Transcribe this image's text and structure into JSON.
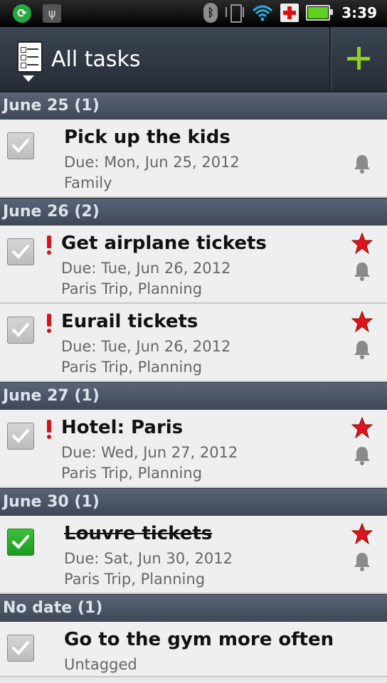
{
  "status_bar": {
    "time": "3:39",
    "icons": [
      "sync-icon",
      "usb-icon",
      "bluetooth-icon",
      "vibrate-icon",
      "wifi-icon",
      "medical-icon",
      "battery-icon"
    ],
    "battery_color": "#5fd21f"
  },
  "header": {
    "title": "All tasks",
    "list_icon": "task-list-icon",
    "add_icon": "plus-icon",
    "add_color": "#8ed120"
  },
  "sections": [
    {
      "label": "June 25 (1)",
      "tasks": [
        {
          "title": "Pick up the kids",
          "due": "Due: Mon, Jun 25, 2012",
          "tags": "Family",
          "priority": false,
          "starred": false,
          "reminder": true,
          "done": false
        }
      ]
    },
    {
      "label": "June 26 (2)",
      "tasks": [
        {
          "title": "Get airplane tickets",
          "due": "Due: Tue, Jun 26, 2012",
          "tags": "Paris Trip, Planning",
          "priority": true,
          "starred": true,
          "reminder": true,
          "done": false
        },
        {
          "title": "Eurail tickets",
          "due": "Due: Tue, Jun 26, 2012",
          "tags": "Paris Trip, Planning",
          "priority": true,
          "starred": true,
          "reminder": true,
          "done": false
        }
      ]
    },
    {
      "label": "June 27 (1)",
      "tasks": [
        {
          "title": "Hotel: Paris",
          "due": "Due: Wed, Jun 27, 2012",
          "tags": "Paris Trip, Planning",
          "priority": true,
          "starred": true,
          "reminder": true,
          "done": false
        }
      ]
    },
    {
      "label": "June 30 (1)",
      "tasks": [
        {
          "title": "Louvre tickets",
          "due": "Due: Sat, Jun 30, 2012",
          "tags": "Paris Trip, Planning",
          "priority": false,
          "starred": true,
          "reminder": true,
          "done": true
        }
      ]
    },
    {
      "label": "No date (1)",
      "tasks": [
        {
          "title": "Go to the gym more often",
          "due": "",
          "tags": "Untagged",
          "priority": false,
          "starred": false,
          "reminder": false,
          "done": false
        }
      ]
    }
  ],
  "colors": {
    "priority": "#d2141c",
    "star": "#e0141c",
    "checked": "#2fb32f",
    "section_header": "#4a5465"
  }
}
